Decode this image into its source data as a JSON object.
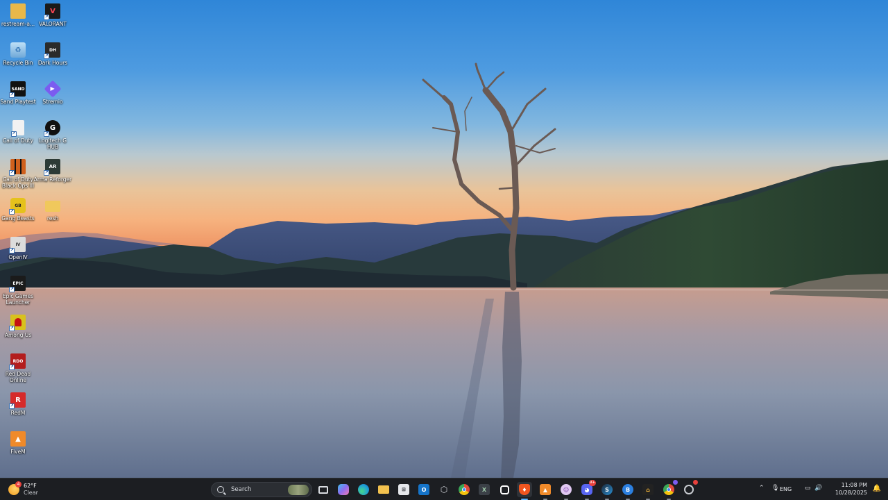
{
  "desktop": {
    "icons": [
      {
        "label": "restream-a...",
        "icon": "folder-icon",
        "color": "#e8b84a"
      },
      {
        "label": "VALORANT",
        "icon": "valorant-icon",
        "color": "#d83a3a"
      },
      {
        "label": "Recycle Bin",
        "icon": "recycle-bin-icon",
        "color": "#7fb5e6"
      },
      {
        "label": "Dark Hours",
        "icon": "dark-hours-icon",
        "color": "#2a2a2a"
      },
      {
        "label": "Sand Playtest",
        "icon": "sand-icon",
        "color": "#111111"
      },
      {
        "label": "Stremio",
        "icon": "stremio-icon",
        "color": "#7b5cf0"
      },
      {
        "label": "Call of Duty",
        "icon": "file-icon",
        "color": "#f2f2f2"
      },
      {
        "label": "Logitech G HUB",
        "icon": "logitech-icon",
        "color": "#111111"
      },
      {
        "label": "Call of Duty Black Ops III",
        "icon": "black-ops-icon",
        "color": "#d0601c"
      },
      {
        "label": "Arma Reforger",
        "icon": "arma-icon",
        "color": "#2d3b36"
      },
      {
        "label": "Gang Beasts",
        "icon": "gang-beasts-icon",
        "color": "#e5c21c"
      },
      {
        "label": "resh",
        "icon": "folder-icon",
        "color": "#f0c85c"
      },
      {
        "label": "OpenIV",
        "icon": "openiv-icon",
        "color": "#dcdcdc"
      },
      {
        "label": "Epic Games Launcher",
        "icon": "epic-games-icon",
        "color": "#1b1b1b"
      },
      {
        "label": "Among Us",
        "icon": "among-us-icon",
        "color": "#d8c11d"
      },
      {
        "label": "Red Dead Online",
        "icon": "red-dead-icon",
        "color": "#b31d1d"
      },
      {
        "label": "RedM",
        "icon": "redm-icon",
        "color": "#d62a2a"
      },
      {
        "label": "FiveM",
        "icon": "fivem-icon",
        "color": "#f08a2a"
      }
    ]
  },
  "taskbar": {
    "weather": {
      "temp": "62°F",
      "condition": "Clear",
      "badge": "4"
    },
    "search": {
      "placeholder": "Search"
    },
    "apps": [
      {
        "name": "start-button",
        "icon": "windows-icon",
        "color": "#3aa0ff"
      },
      {
        "name": "task-view-button",
        "icon": "task-view-icon",
        "color": "#d9dce1"
      },
      {
        "name": "copilot-button",
        "icon": "copilot-icon",
        "color": "#8c6cf0"
      },
      {
        "name": "edge-button",
        "icon": "edge-icon",
        "color": "#1f9fd6"
      },
      {
        "name": "file-explorer-button",
        "icon": "folder-icon",
        "color": "#f2c14e"
      },
      {
        "name": "store-button",
        "icon": "store-icon",
        "color": "#e5e7eb"
      },
      {
        "name": "outlook-button",
        "icon": "outlook-icon",
        "color": "#1574c9"
      },
      {
        "name": "unity-button",
        "icon": "unity-icon",
        "color": "#cfd2d7"
      },
      {
        "name": "chrome-button",
        "icon": "chrome-icon",
        "color": "#e04a3a"
      },
      {
        "name": "excel-button",
        "icon": "excel-icon",
        "color": "#3b4047"
      },
      {
        "name": "capcut-button",
        "icon": "capcut-icon",
        "color": "#ffffff"
      },
      {
        "name": "brave-button",
        "icon": "brave-icon",
        "color": "#f0551f"
      },
      {
        "name": "fivem-taskbar-button",
        "icon": "fivem-icon",
        "color": "#f08a2a"
      },
      {
        "name": "app-purple-button",
        "icon": "app-icon",
        "color": "#e0c8f2"
      },
      {
        "name": "discord-button",
        "icon": "discord-icon",
        "color": "#5865f2",
        "badge": "9+"
      },
      {
        "name": "steam-button",
        "icon": "steam-icon",
        "color": "#2a8fd3"
      },
      {
        "name": "battlenet-button",
        "icon": "battlenet-icon",
        "color": "#2b7fe0"
      },
      {
        "name": "game-app-button",
        "icon": "game-icon",
        "color": "#f3b63a"
      },
      {
        "name": "chrome-profile-button",
        "icon": "chrome-icon",
        "color": "#3aa757"
      },
      {
        "name": "app-last-button",
        "icon": "app-icon",
        "color": "#9aa0a8"
      }
    ],
    "tray": {
      "language": "ENG",
      "time": "11:08 PM",
      "date": "10/28/2025"
    }
  }
}
